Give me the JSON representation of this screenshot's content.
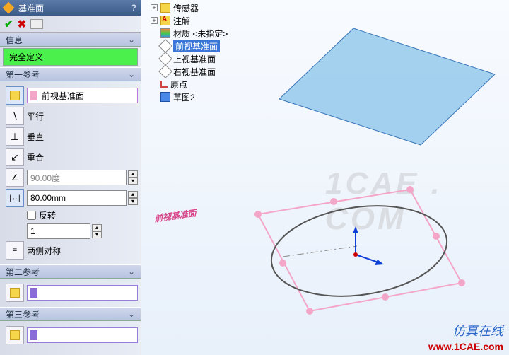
{
  "panel": {
    "title": "基准面",
    "help": "?",
    "ok": "✔",
    "cancel": "✖",
    "pushpin": "—□",
    "info_header": "信息",
    "status": "完全定义",
    "ref1_header": "第一参考",
    "ref1_face": "前视基准面",
    "parallel": "平行",
    "perp": "垂直",
    "coincident": "重合",
    "angle_val": "90.00度",
    "dist_val": "80.00mm",
    "reverse": "反转",
    "count": "1",
    "both_sides": "两侧对称",
    "ref2_header": "第二参考",
    "ref3_header": "第三参考"
  },
  "tree": {
    "item0": "传感器",
    "item1": "注解",
    "item2": "材质 <未指定>",
    "item3": "前视基准面",
    "item4": "上视基准面",
    "item5": "右视基准面",
    "item6": "原点",
    "item7": "草图2"
  },
  "scene": {
    "plane_label": "前视基准面"
  },
  "watermark": "1CAE . COM",
  "branding": "仿真在线",
  "url": "www.1CAE.com"
}
